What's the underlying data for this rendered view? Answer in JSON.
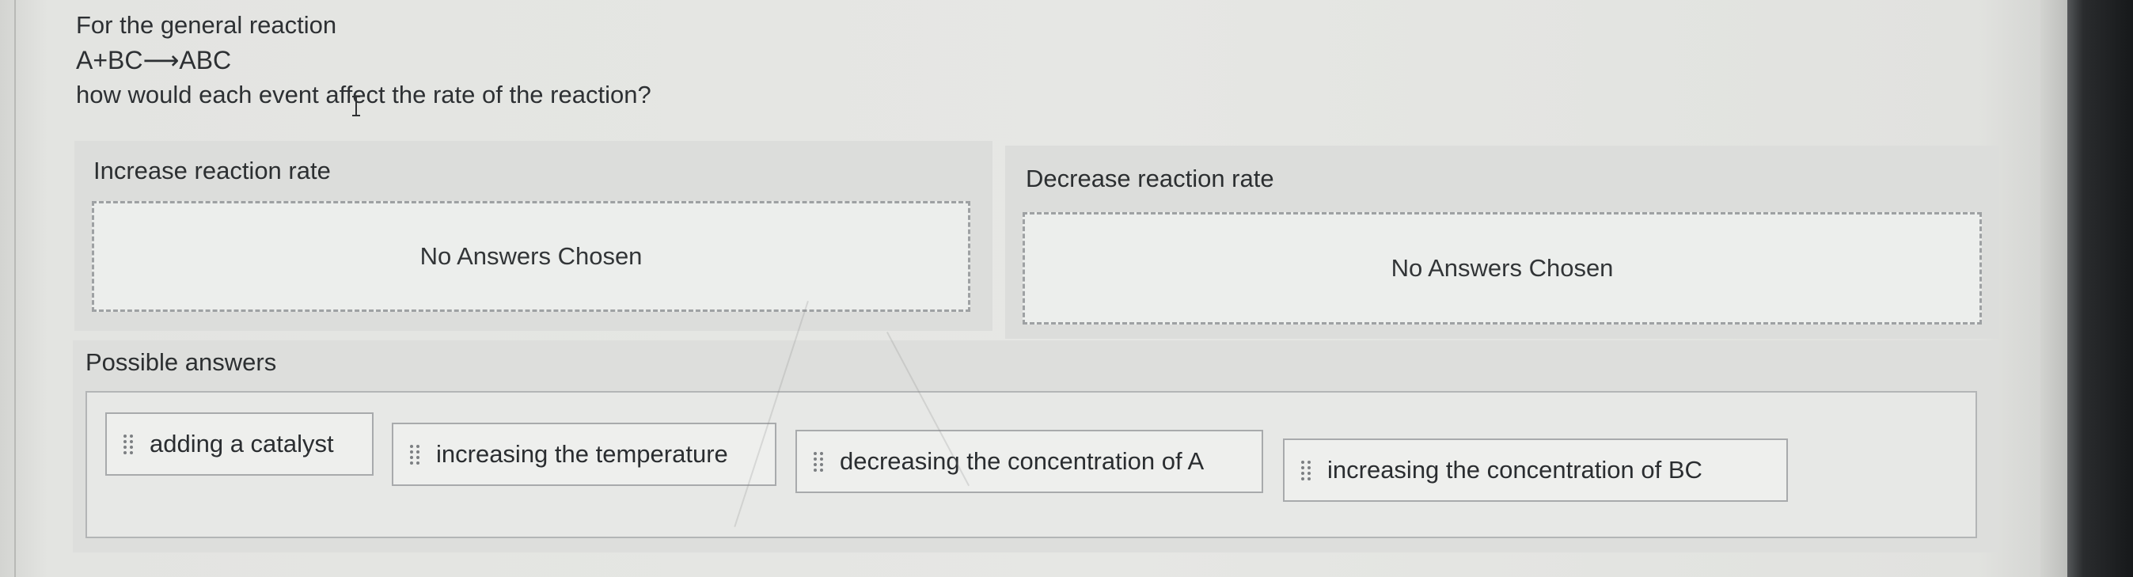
{
  "question": {
    "intro": "For the general reaction",
    "equation": "A+BC⟶ABC",
    "prompt": "how would each event affect the rate of the reaction?"
  },
  "categories": [
    {
      "label": "Increase reaction rate",
      "empty_text": "No Answers Chosen"
    },
    {
      "label": "Decrease reaction rate",
      "empty_text": "No Answers Chosen"
    }
  ],
  "possible_answers": {
    "label": "Possible answers",
    "items": [
      "adding a catalyst",
      "increasing the temperature",
      "decreasing the concentration of A",
      "increasing the concentration of BC"
    ]
  },
  "icons": {
    "drag_handle": "drag-handle-icon",
    "text_cursor": "text-cursor-icon"
  },
  "colors": {
    "panel_bg": "#dcdddb",
    "dropzone_border": "#9ea1a3",
    "chip_border": "#a8aaac",
    "text": "#2d3033"
  }
}
